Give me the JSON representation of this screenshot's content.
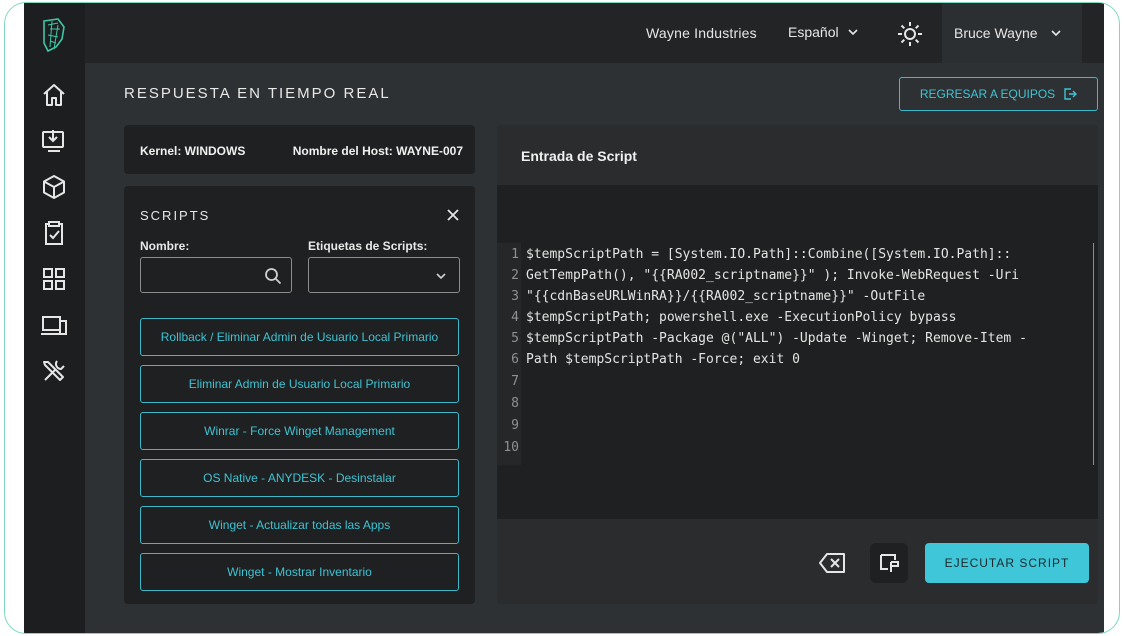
{
  "topbar": {
    "company": "Wayne Industries",
    "language": "Español",
    "user": "Bruce Wayne"
  },
  "page": {
    "title": "RESPUESTA EN TIEMPO REAL",
    "back_button": "REGRESAR A EQUIPOS"
  },
  "host": {
    "kernel": "Kernel: WINDOWS",
    "hostname": "Nombre del Host: WAYNE-007"
  },
  "scripts": {
    "title": "SCRIPTS",
    "name_label": "Nombre:",
    "tags_label": "Etiquetas de Scripts:",
    "name_value": "",
    "items": [
      "Rollback / Eliminar Admin de Usuario Local Primario",
      "Eliminar Admin de Usuario Local Primario",
      "Winrar - Force Winget Management",
      "OS Native - ANYDESK - Desinstalar",
      "Winget - Actualizar todas las Apps",
      "Winget - Mostrar Inventario"
    ]
  },
  "editor": {
    "title": "Entrada de Script",
    "line_numbers": [
      "1",
      "2",
      "3",
      "4",
      "5",
      "6",
      "7",
      "8",
      "9",
      "10"
    ],
    "lines": [
      "$tempScriptPath = [System.IO.Path]::Combine([System.IO.Path]::",
      "GetTempPath(), \"{{RA002_scriptname}}\" ); Invoke-WebRequest -Uri",
      "\"{{cdnBaseURLWinRA}}/{{RA002_scriptname}}\" -OutFile",
      "$tempScriptPath; powershell.exe -ExecutionPolicy bypass",
      "$tempScriptPath -Package @(\"ALL\") -Update -Winget; Remove-Item -",
      "Path $tempScriptPath -Force; exit 0",
      "",
      "",
      "",
      ""
    ],
    "run_button": "EJECUTAR SCRIPT"
  },
  "colors": {
    "accent": "#3fc6d8",
    "sidebar_bg": "#1c1e1f",
    "panel_bg": "#1e2021",
    "page_bg": "#2e3133"
  },
  "icons": {
    "nav": [
      "home-icon",
      "download-computer-icon",
      "cube-icon",
      "clipboard-check-icon",
      "apps-grid-icon",
      "devices-icon",
      "tools-icon"
    ]
  }
}
